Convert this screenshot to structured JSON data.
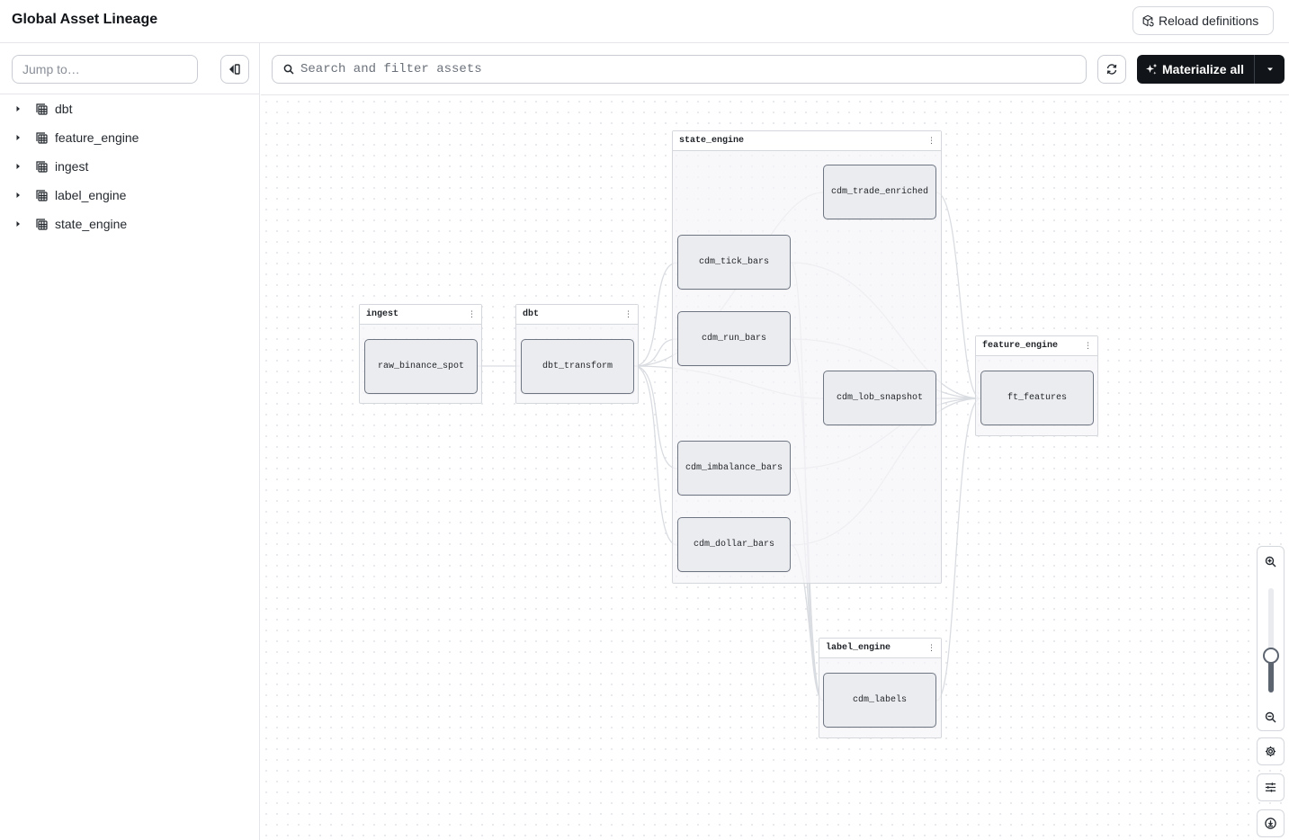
{
  "header": {
    "title": "Global Asset Lineage",
    "reload_label": "Reload definitions"
  },
  "sidebar": {
    "jump_placeholder": "Jump to…",
    "items": [
      {
        "label": "dbt"
      },
      {
        "label": "feature_engine"
      },
      {
        "label": "ingest"
      },
      {
        "label": "label_engine"
      },
      {
        "label": "state_engine"
      }
    ]
  },
  "toolbar": {
    "search_placeholder": "Search and filter assets",
    "materialize_label": "Materialize all"
  },
  "graph": {
    "groups": [
      {
        "name": "ingest",
        "assets": [
          "raw_binance_spot"
        ]
      },
      {
        "name": "dbt",
        "assets": [
          "dbt_transform"
        ]
      },
      {
        "name": "state_engine",
        "assets": [
          "cdm_trade_enriched",
          "cdm_tick_bars",
          "cdm_run_bars",
          "cdm_lob_snapshot",
          "cdm_imbalance_bars",
          "cdm_dollar_bars"
        ]
      },
      {
        "name": "feature_engine",
        "assets": [
          "ft_features"
        ]
      },
      {
        "name": "label_engine",
        "assets": [
          "cdm_labels"
        ]
      }
    ]
  },
  "zoom": {
    "level": 0.35
  },
  "colors": {
    "accent": "#111418",
    "edge": "#d9dce1",
    "node_border": "#6f7683",
    "node_fill": "#ebecef"
  }
}
